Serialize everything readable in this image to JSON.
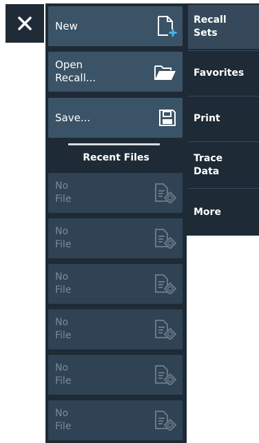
{
  "close_button": {
    "label": "✕"
  },
  "menu": {
    "new_label": "New",
    "open_label": "Open\nRecall...",
    "save_label": "Save...",
    "recent_title": "Recent Files",
    "recent_items": [
      "No\nFile",
      "No\nFile",
      "No\nFile",
      "No\nFile",
      "No\nFile",
      "No\nFile"
    ]
  },
  "side_tabs": [
    {
      "label": "Recall\nSets"
    },
    {
      "label": "Favorites"
    },
    {
      "label": "Print"
    },
    {
      "label": "Trace\nData"
    },
    {
      "label": "More"
    }
  ]
}
